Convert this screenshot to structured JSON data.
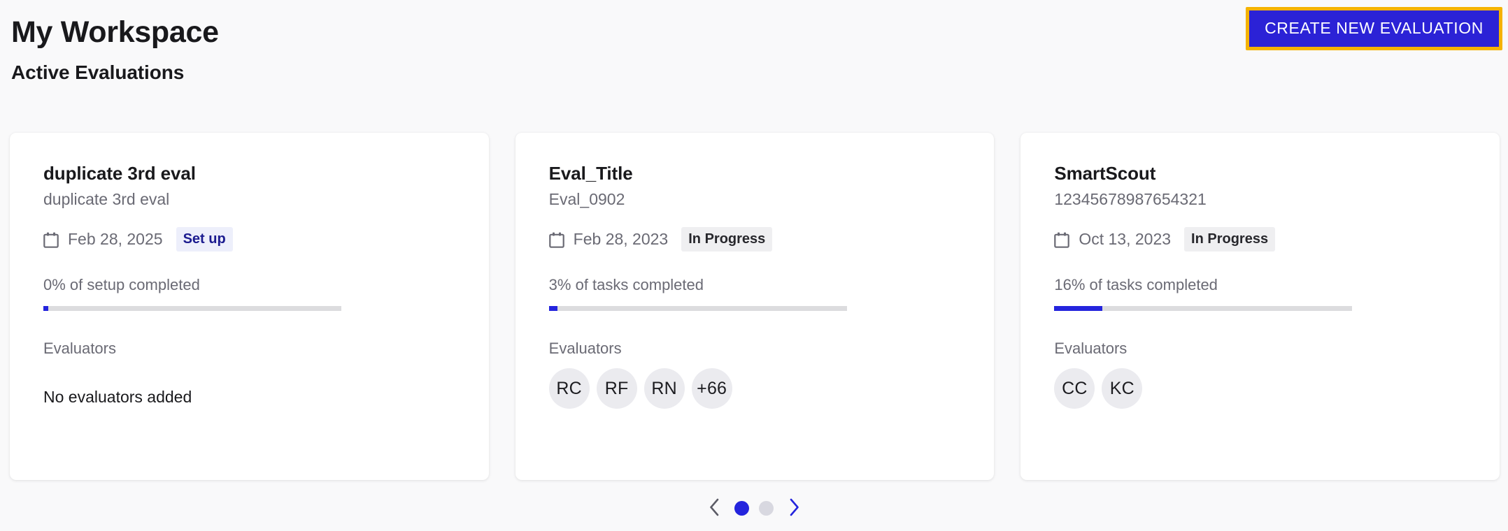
{
  "header": {
    "title": "My Workspace",
    "create_button_label": "CREATE NEW EVALUATION",
    "section_title": "Active Evaluations"
  },
  "colors": {
    "accent_blue": "#2424DD",
    "highlight_gold": "#F5B301",
    "page_background": "#F9F9FA",
    "card_background": "#FFFFFF",
    "muted_text": "#6A6A74",
    "progress_track": "#DCDCDE",
    "badge_setup_bg": "#EDEFFB",
    "badge_setup_text": "#1B1B8F",
    "badge_progress_bg": "#EFEFF1",
    "badge_progress_text": "#27272C",
    "avatar_bg": "#EBEBEF"
  },
  "cards": [
    {
      "title": "duplicate 3rd eval",
      "subtitle": "duplicate 3rd eval",
      "date_icon": "calendar-icon",
      "date": "Feb 28, 2025",
      "status": "Set up",
      "status_type": "setup",
      "progress_label": "0% of setup completed",
      "progress_percent": 0,
      "evaluators_label": "Evaluators",
      "evaluators": [],
      "empty_evaluators_text": "No evaluators added"
    },
    {
      "title": "Eval_Title",
      "subtitle": "Eval_0902",
      "date_icon": "calendar-icon",
      "date": "Feb 28, 2023",
      "status": "In Progress",
      "status_type": "progress",
      "progress_label": "3% of tasks completed",
      "progress_percent": 3,
      "evaluators_label": "Evaluators",
      "evaluators": [
        "RC",
        "RF",
        "RN",
        "+66"
      ],
      "empty_evaluators_text": ""
    },
    {
      "title": "SmartScout",
      "subtitle": "12345678987654321",
      "date_icon": "calendar-icon",
      "date": "Oct 13, 2023",
      "status": "In Progress",
      "status_type": "progress",
      "progress_label": "16% of tasks completed",
      "progress_percent": 16,
      "evaluators_label": "Evaluators",
      "evaluators": [
        "CC",
        "KC"
      ],
      "empty_evaluators_text": ""
    }
  ],
  "pagination": {
    "prev_icon": "chevron-left-icon",
    "next_icon": "chevron-right-icon",
    "total_pages": 2,
    "current_page": 1
  }
}
